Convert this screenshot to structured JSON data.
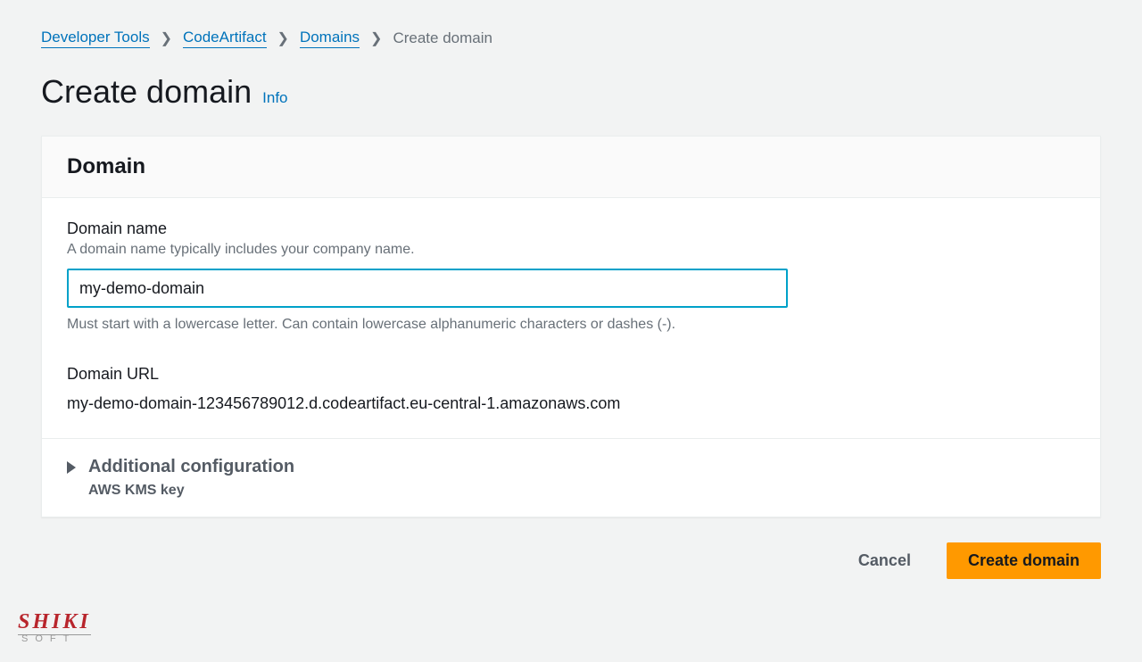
{
  "breadcrumb": {
    "items": [
      {
        "label": "Developer Tools",
        "link": true
      },
      {
        "label": "CodeArtifact",
        "link": true
      },
      {
        "label": "Domains",
        "link": true
      },
      {
        "label": "Create domain",
        "link": false
      }
    ]
  },
  "page": {
    "title": "Create domain",
    "info_label": "Info"
  },
  "panel": {
    "header": "Domain",
    "domain_name": {
      "label": "Domain name",
      "description": "A domain name typically includes your company name.",
      "value": "my-demo-domain",
      "constraint": "Must start with a lowercase letter. Can contain lowercase alphanumeric characters or dashes (-)."
    },
    "domain_url": {
      "label": "Domain URL",
      "value": "my-demo-domain-123456789012.d.codeartifact.eu-central-1.amazonaws.com"
    },
    "additional": {
      "title": "Additional configuration",
      "subtitle": "AWS KMS key"
    }
  },
  "buttons": {
    "cancel": "Cancel",
    "create": "Create domain"
  },
  "logo": {
    "main": "SHIKI",
    "sub": "SOFT"
  }
}
